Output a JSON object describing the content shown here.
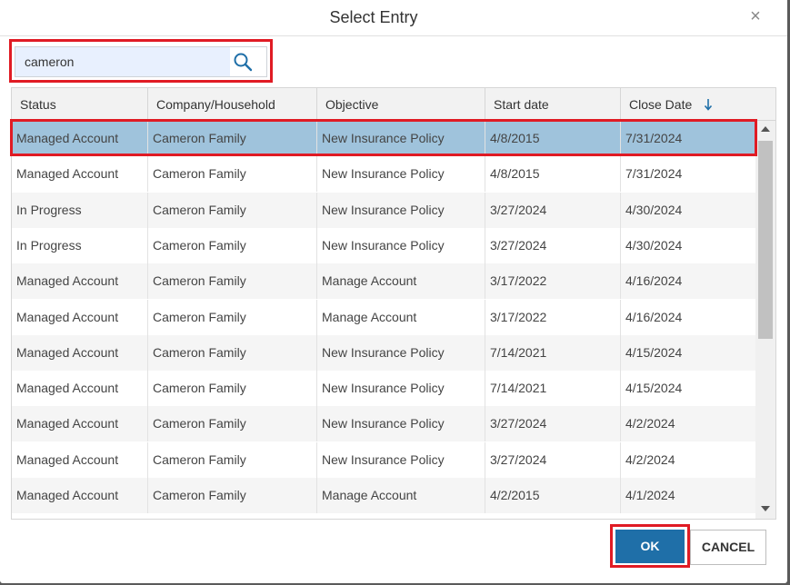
{
  "dialog": {
    "title": "Select Entry",
    "close_glyph": "×"
  },
  "search": {
    "value": "cameron",
    "placeholder": ""
  },
  "table": {
    "columns": [
      "Status",
      "Company/Household",
      "Objective",
      "Start date",
      "Close Date"
    ],
    "sort": {
      "column": "Close Date",
      "direction": "descending"
    },
    "selected_row": 0,
    "rows": [
      [
        "Managed Account",
        "Cameron Family",
        "New Insurance Policy",
        "4/8/2015",
        "7/31/2024"
      ],
      [
        "Managed Account",
        "Cameron Family",
        "New Insurance Policy",
        "4/8/2015",
        "7/31/2024"
      ],
      [
        "In Progress",
        "Cameron Family",
        "New Insurance Policy",
        "3/27/2024",
        "4/30/2024"
      ],
      [
        "In Progress",
        "Cameron Family",
        "New Insurance Policy",
        "3/27/2024",
        "4/30/2024"
      ],
      [
        "Managed Account",
        "Cameron Family",
        "Manage Account",
        "3/17/2022",
        "4/16/2024"
      ],
      [
        "Managed Account",
        "Cameron Family",
        "Manage Account",
        "3/17/2022",
        "4/16/2024"
      ],
      [
        "Managed Account",
        "Cameron Family",
        "New Insurance Policy",
        "7/14/2021",
        "4/15/2024"
      ],
      [
        "Managed Account",
        "Cameron Family",
        "New Insurance Policy",
        "7/14/2021",
        "4/15/2024"
      ],
      [
        "Managed Account",
        "Cameron Family",
        "New Insurance Policy",
        "3/27/2024",
        "4/2/2024"
      ],
      [
        "Managed Account",
        "Cameron Family",
        "New Insurance Policy",
        "3/27/2024",
        "4/2/2024"
      ],
      [
        "Managed Account",
        "Cameron Family",
        "Manage Account",
        "4/2/2015",
        "4/1/2024"
      ]
    ]
  },
  "footer": {
    "ok_label": "OK",
    "cancel_label": "CANCEL"
  },
  "colors": {
    "selected_row": "#9fc3dc",
    "highlight_box": "#e01b24",
    "primary_button": "#1f6fa8",
    "sort_arrow": "#1f6fa8"
  },
  "icons": {
    "search": "search-icon",
    "sort": "sort-descending-icon",
    "close": "close-icon"
  }
}
